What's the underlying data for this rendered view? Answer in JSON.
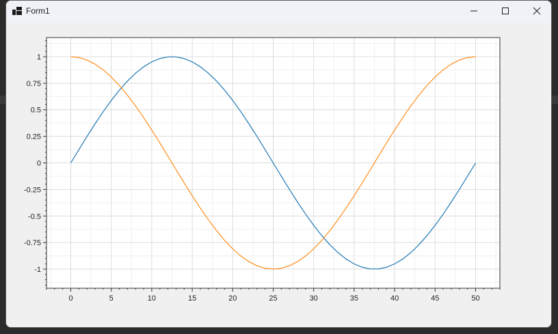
{
  "window": {
    "title": "Form1",
    "icon": "app-window-icon",
    "controls": [
      "minimize-icon",
      "maximize-icon",
      "close-icon"
    ]
  },
  "chart_data": {
    "type": "line",
    "title": "",
    "xlabel": "",
    "ylabel": "",
    "xlim": [
      -3,
      53
    ],
    "ylim": [
      -1.18,
      1.18
    ],
    "grid": true,
    "x_ticks": [
      0,
      5,
      10,
      15,
      20,
      25,
      30,
      35,
      40,
      45,
      50
    ],
    "y_ticks": [
      1,
      0.75,
      0.5,
      0.25,
      0,
      -0.25,
      -0.5,
      -0.75,
      -1
    ],
    "x": [
      0,
      1,
      2,
      3,
      4,
      5,
      6,
      7,
      8,
      9,
      10,
      11,
      12,
      13,
      14,
      15,
      16,
      17,
      18,
      19,
      20,
      21,
      22,
      23,
      24,
      25,
      26,
      27,
      28,
      29,
      30,
      31,
      32,
      33,
      34,
      35,
      36,
      37,
      38,
      39,
      40,
      41,
      42,
      43,
      44,
      45,
      46,
      47,
      48,
      49,
      50
    ],
    "series": [
      {
        "color": "#1f77b4",
        "values": [
          0,
          0.1253,
          0.2487,
          0.3681,
          0.4818,
          0.5878,
          0.6845,
          0.7705,
          0.8443,
          0.9048,
          0.9511,
          0.9823,
          0.998,
          0.998,
          0.9823,
          0.9511,
          0.9048,
          0.8443,
          0.7705,
          0.6845,
          0.5878,
          0.4818,
          0.3681,
          0.2487,
          0.1253,
          0,
          -0.1253,
          -0.2487,
          -0.3681,
          -0.4818,
          -0.5878,
          -0.6845,
          -0.7705,
          -0.8443,
          -0.9048,
          -0.9511,
          -0.9823,
          -0.998,
          -0.998,
          -0.9823,
          -0.9511,
          -0.9048,
          -0.8443,
          -0.7705,
          -0.6845,
          -0.5878,
          -0.4818,
          -0.3681,
          -0.2487,
          -0.1253,
          0
        ]
      },
      {
        "color": "#ff8c1a",
        "values": [
          1,
          0.9921,
          0.9686,
          0.9298,
          0.8763,
          0.809,
          0.729,
          0.6374,
          0.5358,
          0.4258,
          0.309,
          0.1874,
          0.0628,
          -0.0628,
          -0.1874,
          -0.309,
          -0.4258,
          -0.5358,
          -0.6374,
          -0.729,
          -0.809,
          -0.8763,
          -0.9298,
          -0.9686,
          -0.9921,
          -1,
          -0.9921,
          -0.9686,
          -0.9298,
          -0.8763,
          -0.809,
          -0.729,
          -0.6374,
          -0.5358,
          -0.4258,
          -0.309,
          -0.1874,
          -0.0628,
          0.0628,
          0.1874,
          0.309,
          0.4258,
          0.5358,
          0.6374,
          0.729,
          0.809,
          0.8763,
          0.9298,
          0.9686,
          0.9921,
          1
        ]
      }
    ]
  }
}
